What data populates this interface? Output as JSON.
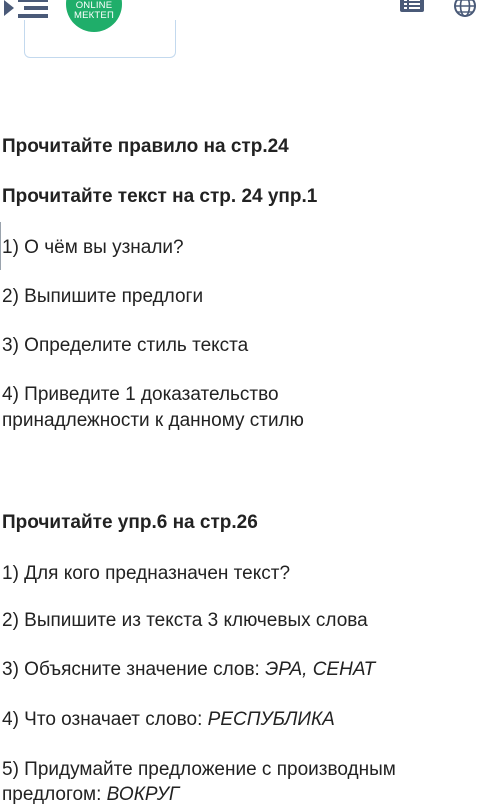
{
  "header": {
    "logo_line1": "ONLINE",
    "logo_line2": "МЕКТЕП",
    "brand_color": "#1fae6a",
    "icons": [
      "menu-icon",
      "list-icon",
      "globe-icon"
    ]
  },
  "content": {
    "heading1": "Прочитайте правило на стр.24",
    "heading2": "Прочитайте текст на стр. 24 упр.1",
    "section1": [
      "1) О чём вы узнали?",
      "2) Выпишите предлоги",
      "3) Определите стиль текста",
      "4) Приведите 1 доказательство",
      "принадлежности к данному стилю"
    ],
    "heading3": "Прочитайте упр.6 на стр.26",
    "section2": {
      "q1": "1) Для кого предназначен текст?",
      "q2": "2) Выпишите из текста 3 ключевых слова",
      "q3_prefix": "3) Объясните значение слов: ",
      "q3_words": "ЭРА, СЕНАТ",
      "q4_prefix": "4) Что означает слово: ",
      "q4_word": "РЕСПУБЛИКА",
      "q5_line1": "5) Придумайте предложение с производным",
      "q5_prefix": "предлогом: ",
      "q5_word": "ВОКРУГ"
    }
  }
}
